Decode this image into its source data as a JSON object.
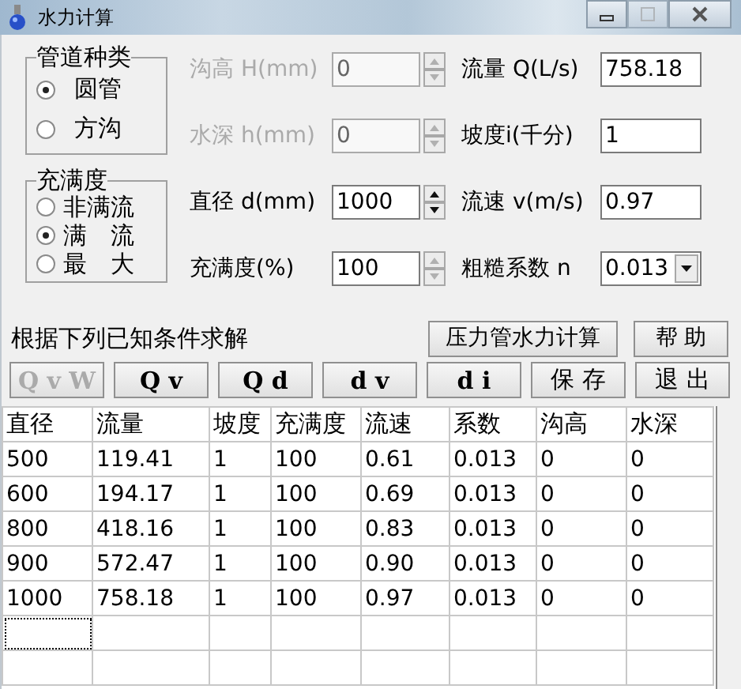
{
  "window": {
    "title": "水力计算",
    "controls": [
      {
        "kind": "minimize",
        "disabled": false
      },
      {
        "kind": "maximize",
        "disabled": true
      },
      {
        "kind": "close",
        "disabled": false
      }
    ]
  },
  "pipe_type": {
    "title": "管道种类",
    "options": [
      {
        "label": "圆管",
        "selected": true
      },
      {
        "label": "方沟",
        "selected": false
      }
    ]
  },
  "fill_mode": {
    "title": "充满度",
    "options": [
      {
        "label": "非满流",
        "selected": false
      },
      {
        "label": "满　流",
        "selected": true
      },
      {
        "label": "最　大",
        "selected": false
      }
    ]
  },
  "left_fields": [
    {
      "label": "沟高 H(mm)",
      "value": "0",
      "kind": "spin",
      "disabled": true,
      "spin_enabled": false
    },
    {
      "label": "水深 h(mm)",
      "value": "0",
      "kind": "spin",
      "disabled": true,
      "spin_enabled": false
    },
    {
      "label": "直径 d(mm)",
      "value": "1000",
      "kind": "spin",
      "disabled": false,
      "spin_enabled": true
    },
    {
      "label": "充满度(%)",
      "value": "100",
      "kind": "spin",
      "disabled": false,
      "spin_enabled": false
    }
  ],
  "right_fields": [
    {
      "label": "流量 Q(L/s)",
      "value": "758.18",
      "kind": "text"
    },
    {
      "label": "坡度i(千分)",
      "value": "1",
      "kind": "text"
    },
    {
      "label": "流速 v(m/s)",
      "value": "0.97",
      "kind": "text"
    },
    {
      "label": "粗糙系数 n",
      "value": "0.013",
      "kind": "dropdown"
    }
  ],
  "prompt": "根据下列已知条件求解",
  "top_buttons": [
    {
      "label": "压力管水力计算",
      "disabled": false,
      "bold": false
    },
    {
      "label": "帮 助",
      "disabled": false,
      "bold": false
    }
  ],
  "solve_buttons": [
    {
      "label": "Q v W",
      "disabled": true,
      "bold": true
    },
    {
      "label": "Q v",
      "disabled": false,
      "bold": true
    },
    {
      "label": "Q d",
      "disabled": false,
      "bold": true
    },
    {
      "label": "d v",
      "disabled": false,
      "bold": true
    },
    {
      "label": "d i",
      "disabled": false,
      "bold": true
    },
    {
      "label": "保 存",
      "disabled": false,
      "bold": false
    },
    {
      "label": "退 出",
      "disabled": false,
      "bold": false
    }
  ],
  "table": {
    "columns": [
      "直径",
      "流量",
      "坡度",
      "充满度",
      "流速",
      "系数",
      "沟高",
      "水深"
    ],
    "rows": [
      [
        "500",
        "119.41",
        "1",
        "100",
        "0.61",
        "0.013",
        "0",
        "0"
      ],
      [
        "600",
        "194.17",
        "1",
        "100",
        "0.69",
        "0.013",
        "0",
        "0"
      ],
      [
        "800",
        "418.16",
        "1",
        "100",
        "0.83",
        "0.013",
        "0",
        "0"
      ],
      [
        "900",
        "572.47",
        "1",
        "100",
        "0.90",
        "0.013",
        "0",
        "0"
      ],
      [
        "1000",
        "758.18",
        "1",
        "100",
        "0.97",
        "0.013",
        "0",
        "0"
      ]
    ]
  }
}
